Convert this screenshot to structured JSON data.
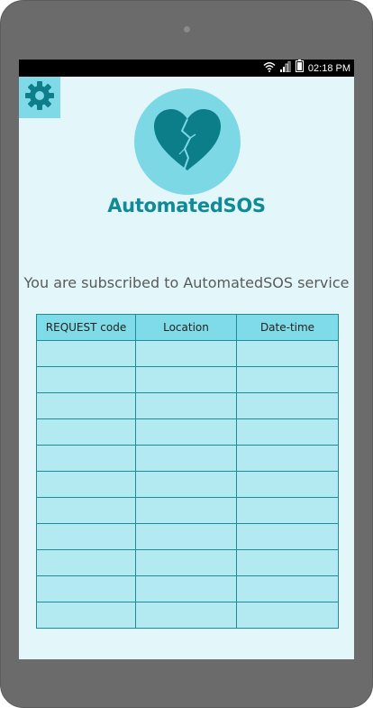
{
  "status_bar": {
    "time": "02:18 PM",
    "icons": [
      "wifi-icon",
      "signal-icon",
      "battery-icon"
    ]
  },
  "settings": {
    "icon": "gear-icon"
  },
  "app": {
    "title": "AutomatedSOS",
    "logo_icon": "broken-heart-icon"
  },
  "subscription": {
    "message": "You are subscribed to AutomatedSOS service"
  },
  "table": {
    "headers": [
      "REQUEST code",
      "Location",
      "Date-time"
    ],
    "rows": [
      [
        "",
        "",
        ""
      ],
      [
        "",
        "",
        ""
      ],
      [
        "",
        "",
        ""
      ],
      [
        "",
        "",
        ""
      ],
      [
        "",
        "",
        ""
      ],
      [
        "",
        "",
        ""
      ],
      [
        "",
        "",
        ""
      ],
      [
        "",
        "",
        ""
      ],
      [
        "",
        "",
        ""
      ],
      [
        "",
        "",
        ""
      ],
      [
        "",
        "",
        ""
      ]
    ]
  },
  "colors": {
    "screen_bg": "#e3f7fa",
    "accent": "#0f8a96",
    "logo_circle": "#7dd8e6",
    "settings_bg": "#7fd9e6",
    "table_header_bg": "#7fdbe8",
    "table_cell_bg": "#b3eaf2",
    "table_border": "#1e8b96",
    "device_frame": "#6b6b6b"
  }
}
